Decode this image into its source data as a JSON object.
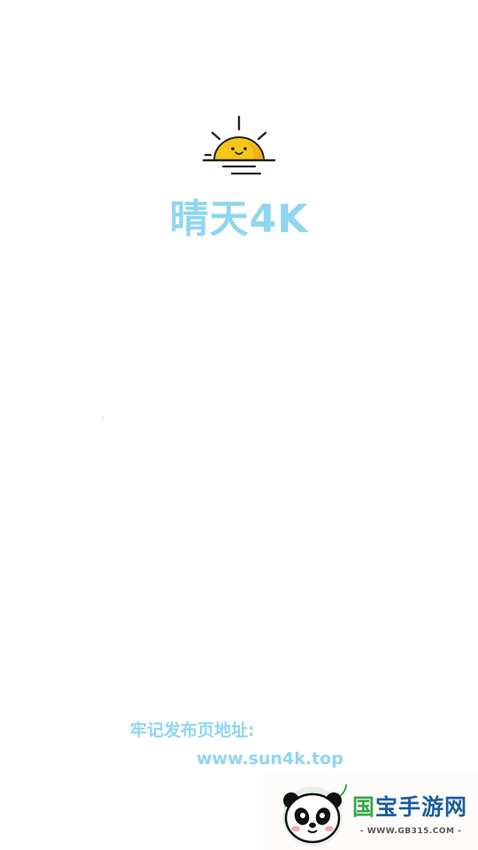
{
  "app": {
    "name": "晴天4K",
    "logo_icon": "sunrise-icon"
  },
  "footer": {
    "publish_label": "牢记发布页地址:",
    "publish_url": "www.sun4k.top"
  },
  "watermark": {
    "title_first_char": "国",
    "title_rest": "宝手游网",
    "url": "- WWW.GB315.COM -",
    "icon": "panda-icon"
  },
  "colors": {
    "accent": "#8fd6f1",
    "sun": "#f5c518",
    "watermark_blue": "#1d5f9e",
    "watermark_green": "#39a64a"
  }
}
